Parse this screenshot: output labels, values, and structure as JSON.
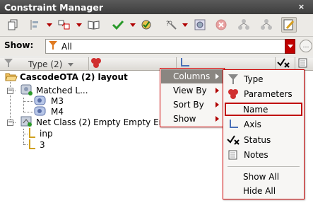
{
  "window": {
    "title": "Constraint Manager",
    "close_glyph": "×"
  },
  "toolbar": {
    "buttons": [
      "copy-icon",
      "align-icon",
      "compare-icon",
      "book-icon",
      "check-icon",
      "net-check-icon",
      "key-icon",
      "target-icon",
      "cancel-icon",
      "tree-icon",
      "tree-export-icon",
      "notes-edit-icon"
    ]
  },
  "show": {
    "label": "Show:",
    "value": "All",
    "more_glyph": "…"
  },
  "columns": {
    "type_label": "Type (2)"
  },
  "tree": {
    "root": "CascodeOTA (2) layout",
    "group1": "Matched L...",
    "m3": "M3",
    "m4": "M4",
    "group2": "Net Class (2)  Empty Empty Em",
    "inp": "inp",
    "n3": "3"
  },
  "context_menu": {
    "items": [
      "Columns",
      "View By",
      "Sort By",
      "Show"
    ]
  },
  "columns_submenu": {
    "items": [
      "Type",
      "Parameters",
      "Name",
      "Axis",
      "Status",
      "Notes"
    ],
    "show_all": "Show All",
    "hide_all": "Hide All"
  },
  "colors": {
    "accent_red": "#c00000",
    "title_bg": "#4a4a4a",
    "menu_active": "#8a8681"
  }
}
